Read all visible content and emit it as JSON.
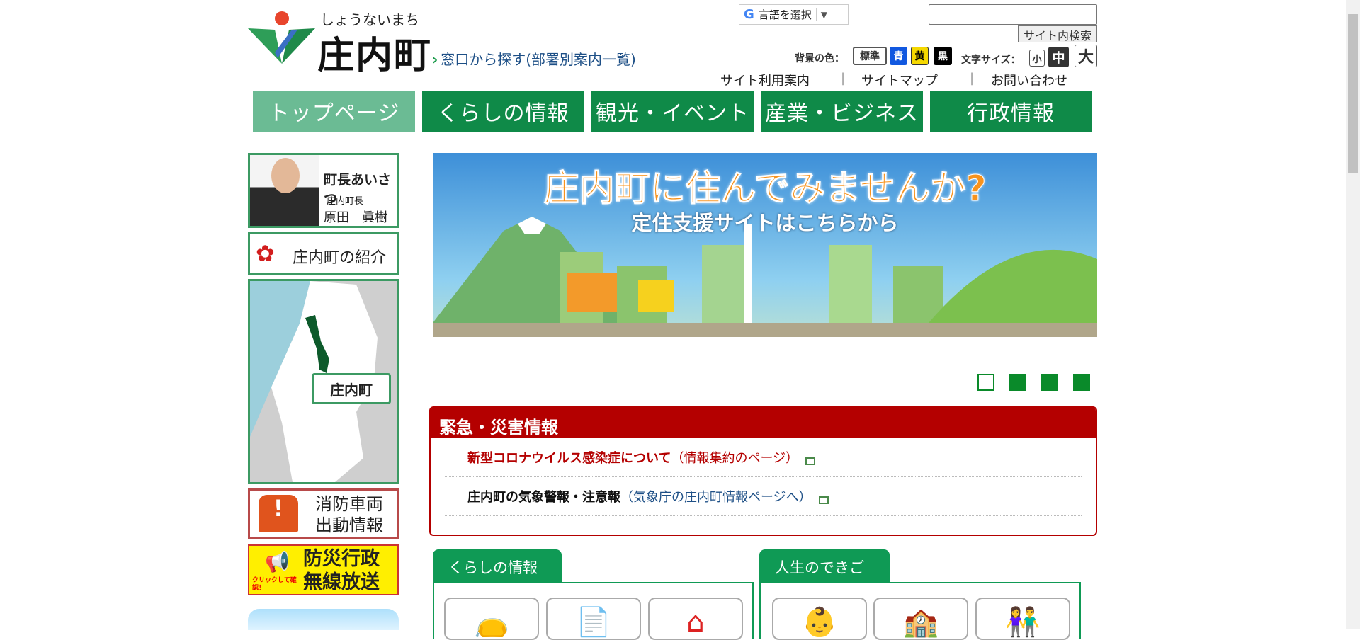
{
  "header": {
    "logo_kana": "しょうないまち",
    "logo_name": "庄内町",
    "dept_link": "窓口から探す(部署別案内一覧)",
    "translate_label": "言語を選択",
    "search_placeholder": "",
    "search_button": "サイト内検索",
    "bg_color_label": "背景の色：",
    "bg_colors": [
      "標準",
      "青",
      "黄",
      "黒"
    ],
    "font_size_label": "文字サイズ：",
    "font_sizes": [
      "小",
      "中",
      "大"
    ],
    "util_links": [
      "サイト利用案内",
      "サイトマップ",
      "お問い合わせ"
    ],
    "util_sep": "|"
  },
  "nav": [
    "トップページ",
    "くらしの情報",
    "観光・イベント",
    "産業・ビジネス",
    "行政情報"
  ],
  "sidebar": {
    "greeting_title": "町長あいさつ",
    "greeting_role": "庄内町長",
    "greeting_name": "原田　眞樹",
    "intro": "庄内町の紹介",
    "map_label": "庄内町",
    "fire": [
      "消防車両",
      "出動情報"
    ],
    "bousai": [
      "防災行政",
      "無線放送"
    ],
    "bousai_note": "クリックして確認！"
  },
  "banner": {
    "title": "庄内町に住んでみませんか?",
    "subtitle": "定住支援サイトはこちらから",
    "slides": 4,
    "active_slide": 1
  },
  "emergency": {
    "title": "緊急・災害情報",
    "items": [
      {
        "text": "新型コロナウイルス感染症について",
        "note": "（情報集約のページ）"
      },
      {
        "text": "庄内町の気象警報・注意報",
        "note": "（気象庁の庄内町情報ページへ）"
      }
    ]
  },
  "sections": {
    "kurashi": "くらしの情報",
    "life": "人生のできごと"
  },
  "colors": {
    "nav": "#0f8a48",
    "emergency": "#b40000",
    "tab": "#0f9a55"
  }
}
